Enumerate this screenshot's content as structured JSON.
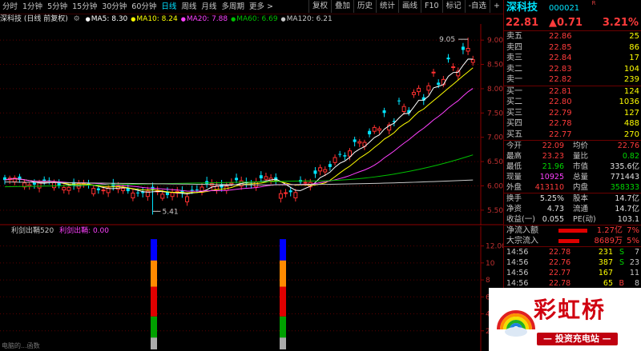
{
  "toolbar": {
    "periods": [
      "分时",
      "1分钟",
      "5分钟",
      "15分钟",
      "30分钟",
      "60分钟",
      "日线",
      "周线",
      "月线",
      "多周期",
      "更多 >"
    ],
    "active_period": "日线",
    "buttons": [
      "复权",
      "叠加",
      "历史",
      "统计",
      "画线",
      "F10",
      "标记",
      "-自选",
      "+"
    ]
  },
  "header": {
    "title": "深科技 (日线 前复权)",
    "ma": [
      {
        "label": "MA5: 8.30",
        "color": "#ffffff"
      },
      {
        "label": "MA10: 8.24",
        "color": "#ffff00"
      },
      {
        "label": "MA20: 7.88",
        "color": "#ff40ff"
      },
      {
        "label": "MA60: 6.69",
        "color": "#00c000"
      },
      {
        "label": "MA120: 6.21",
        "color": "#c8c8c8"
      }
    ]
  },
  "kchart": {
    "yticks": [
      "9.00",
      "8.50",
      "8.00",
      "7.50",
      "7.00",
      "6.50",
      "6.00",
      "5.50"
    ],
    "high_label": "9.05",
    "low_label": "5.41"
  },
  "subchart": {
    "title": "利剑出鞘520",
    "series_label": "利剑出鞘: 0.00",
    "yticks": [
      "12.00",
      "10",
      "8",
      "6",
      "4",
      "2"
    ],
    "footer": "电脑的...函数"
  },
  "panel": {
    "name": "深科技",
    "code": "000021",
    "r_badge": "R",
    "price": "22.81",
    "change": "▲0.71",
    "change_pct": "3.21%",
    "asks": [
      {
        "label": "卖五",
        "price": "22.86",
        "vol": "25"
      },
      {
        "label": "卖四",
        "price": "22.85",
        "vol": "86"
      },
      {
        "label": "卖三",
        "price": "22.84",
        "vol": "17"
      },
      {
        "label": "卖二",
        "price": "22.83",
        "vol": "104"
      },
      {
        "label": "卖一",
        "price": "22.82",
        "vol": "239"
      }
    ],
    "bids": [
      {
        "label": "买一",
        "price": "22.81",
        "vol": "124"
      },
      {
        "label": "买二",
        "price": "22.80",
        "vol": "1036"
      },
      {
        "label": "买三",
        "price": "22.79",
        "vol": "127"
      },
      {
        "label": "买四",
        "price": "22.78",
        "vol": "488"
      },
      {
        "label": "买五",
        "price": "22.77",
        "vol": "270"
      }
    ],
    "stats": [
      {
        "l1": "今开",
        "v1": "22.09",
        "c1": "red",
        "l2": "均价",
        "v2": "22.76",
        "c2": "red"
      },
      {
        "l1": "最高",
        "v1": "23.23",
        "c1": "red",
        "l2": "量比",
        "v2": "0.82",
        "c2": "green"
      },
      {
        "l1": "最低",
        "v1": "21.96",
        "c1": "green",
        "l2": "市值",
        "v2": "335.6亿",
        "c2": "white"
      },
      {
        "l1": "现量",
        "v1": "10925",
        "c1": "magenta",
        "l2": "总量",
        "v2": "771443",
        "c2": "white"
      },
      {
        "l1": "外盘",
        "v1": "413110",
        "c1": "red",
        "l2": "内盘",
        "v2": "358333",
        "c2": "green"
      }
    ],
    "stats2": [
      {
        "l1": "换手",
        "v1": "5.25%",
        "c1": "white",
        "l2": "股本",
        "v2": "14.7亿",
        "c2": "white"
      },
      {
        "l1": "净资",
        "v1": "4.73",
        "c1": "white",
        "l2": "流通",
        "v2": "14.7亿",
        "c2": "white"
      },
      {
        "l1": "收益(一)",
        "v1": "0.055",
        "c1": "white",
        "l2": "PE(动)",
        "v2": "103.1",
        "c2": "white"
      }
    ],
    "flows": [
      {
        "label": "净流入额",
        "value": "1.27亿",
        "pct": "7%",
        "bar": 0.7
      },
      {
        "label": "大宗流入",
        "value": "8689万",
        "pct": "5%",
        "bar": 0.5
      }
    ],
    "ticks": [
      {
        "time": "14:56",
        "price": "22.78",
        "vol": "231",
        "side": "S",
        "side_color": "green",
        "n": "7"
      },
      {
        "time": "14:56",
        "price": "22.76",
        "vol": "387",
        "side": "S",
        "side_color": "green",
        "n": "23"
      },
      {
        "time": "14:56",
        "price": "22.77",
        "vol": "167",
        "side": "",
        "side_color": "white",
        "n": "11"
      },
      {
        "time": "14:56",
        "price": "22.78",
        "vol": "65",
        "side": "B",
        "side_color": "red",
        "n": "8"
      }
    ]
  },
  "logo": {
    "text": "彩虹桥",
    "subtitle": "— 投资充电站 —"
  }
}
